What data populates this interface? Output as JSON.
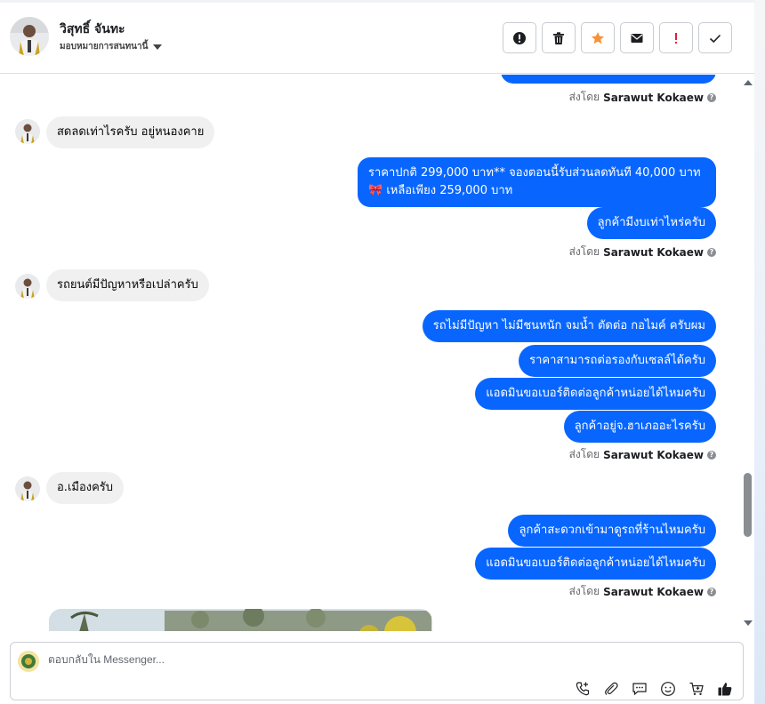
{
  "header": {
    "contact_name": "วิสุทธิ์ จันทะ",
    "assign_label": "มอบหมายการสนทนานี้",
    "toolbar": [
      {
        "name": "mark-spam-button",
        "icon": "alert-circle-icon"
      },
      {
        "name": "delete-button",
        "icon": "trash-icon"
      },
      {
        "name": "star-button",
        "icon": "star-icon"
      },
      {
        "name": "mark-unread-button",
        "icon": "envelope-icon"
      },
      {
        "name": "follow-up-button",
        "icon": "exclamation-icon"
      },
      {
        "name": "mark-done-button",
        "icon": "check-icon"
      }
    ]
  },
  "conversation": {
    "sent_by_prefix": "ส่งโดย",
    "sent_by_name": "Sarawut Kokaew",
    "messages": [
      {
        "id": "m1",
        "dir": "in",
        "text": "สดลดเท่าไรครับ อยู่หนองคาย"
      },
      {
        "id": "m2",
        "dir": "out",
        "line1": "ราคาปกติ  299,000 บาท** จองตอนนี้รับส่วนลดทันที 40,000 บาท",
        "line2": "🎀 เหลือเพียง 259,000 บาท"
      },
      {
        "id": "m3",
        "dir": "out",
        "text": "ลูกค้ามีงบเท่าไหร่ครับ"
      },
      {
        "id": "m4",
        "dir": "in",
        "text": "รถยนต์มีปัญหาหรือเปล่าครับ"
      },
      {
        "id": "m5",
        "dir": "out",
        "text": "รถไม่มีปัญหา ไม่มีชนหนัก จมน้ำ ตัดต่อ กอไมค์ ครับผม"
      },
      {
        "id": "m6",
        "dir": "out",
        "text": "ราคาสามารถต่อรองกับเซลล์ได้ครับ"
      },
      {
        "id": "m7",
        "dir": "out",
        "text": "แอดมินขอเบอร์ติดต่อลูกค้าหน่อยได้ไหมครับ"
      },
      {
        "id": "m8",
        "dir": "out",
        "text": "ลูกค้าอยู่จ.ฮาเภออะไรครับ"
      },
      {
        "id": "m9",
        "dir": "in",
        "text": "อ.เมืองครับ"
      },
      {
        "id": "m10",
        "dir": "out",
        "text": "ลูกค้าสะดวกเข้ามาดูรถที่ร้านไหมครับ"
      },
      {
        "id": "m11",
        "dir": "out",
        "text": "แอดมินขอเบอร์ติดต่อลูกค้าหน่อยได้ไหมครับ"
      }
    ]
  },
  "composer": {
    "placeholder": "ตอบกลับใน Messenger...",
    "tools": [
      "call-add-icon",
      "paperclip-icon",
      "chat-bubble-icon",
      "smiley-icon",
      "cart-icon",
      "thumbs-up-icon"
    ]
  },
  "colors": {
    "outgoing_bubble": "#0866ff",
    "incoming_bubble": "#f0f0f0",
    "star": "#f7923a",
    "follow_up": "#e41e3f"
  }
}
